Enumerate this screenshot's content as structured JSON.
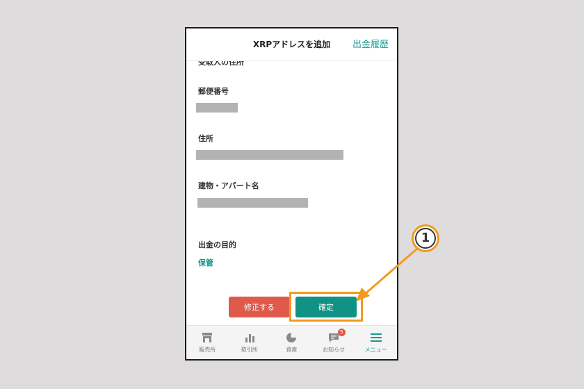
{
  "header": {
    "title": "XRPアドレスを追加",
    "link": "出金履歴"
  },
  "form": {
    "cut_label": "受取人の住所",
    "postal_label": "郵便番号",
    "address_label": "住所",
    "building_label": "建物・アパート名",
    "purpose_label": "出金の目的",
    "purpose_value": "保管"
  },
  "actions": {
    "fix_label": "修正する",
    "confirm_label": "確定"
  },
  "nav": {
    "items": [
      {
        "label": "販売所",
        "icon": "shop-icon"
      },
      {
        "label": "取引所",
        "icon": "bar-chart-icon"
      },
      {
        "label": "資産",
        "icon": "pie-chart-icon"
      },
      {
        "label": "お知らせ",
        "icon": "chat-icon",
        "badge": "5"
      },
      {
        "label": "メニュー",
        "icon": "menu-icon"
      }
    ]
  },
  "annotation": {
    "step": "1"
  },
  "colors": {
    "accent": "#159a8c",
    "danger": "#e05a4b",
    "highlight": "#f29a1e"
  }
}
